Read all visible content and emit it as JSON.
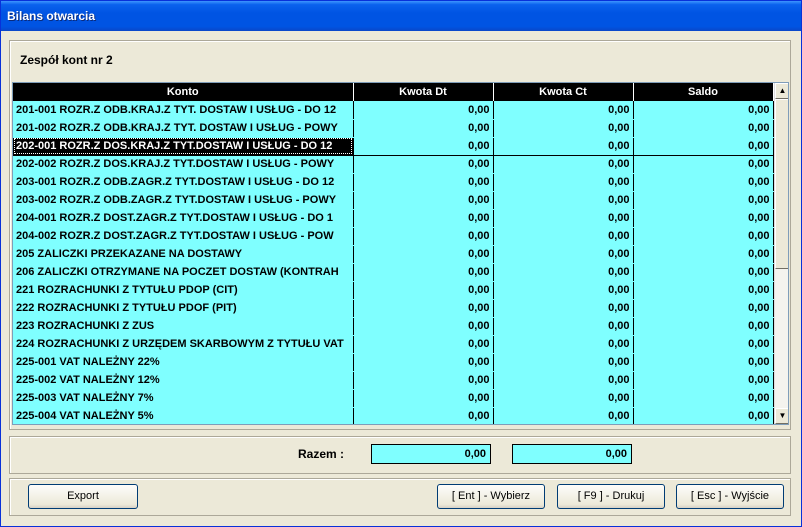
{
  "window": {
    "title": "Bilans otwarcia"
  },
  "group": {
    "title": "Zespół kont nr 2"
  },
  "table": {
    "columns": [
      "Konto",
      "Kwota Dt",
      "Kwota Ct",
      "Saldo"
    ],
    "selected_index": 2,
    "rows": [
      [
        "201-001  ROZR.Z ODB.KRAJ.Z TYT. DOSTAW I USŁUG - DO 12",
        "0,00",
        "0,00",
        "0,00"
      ],
      [
        "201-002  ROZR.Z ODB.KRAJ.Z TYT. DOSTAW I USŁUG - POWY",
        "0,00",
        "0,00",
        "0,00"
      ],
      [
        "202-001  ROZR.Z DOS.KRAJ.Z TYT.DOSTAW I USŁUG - DO 12",
        "0,00",
        "0,00",
        "0,00"
      ],
      [
        "202-002  ROZR.Z DOS.KRAJ.Z TYT.DOSTAW I USŁUG - POWY",
        "0,00",
        "0,00",
        "0,00"
      ],
      [
        "203-001  ROZR.Z ODB.ZAGR.Z TYT.DOSTAW I USŁUG - DO 12",
        "0,00",
        "0,00",
        "0,00"
      ],
      [
        "203-002  ROZR.Z ODB.ZAGR.Z TYT.DOSTAW I USŁUG - POWY",
        "0,00",
        "0,00",
        "0,00"
      ],
      [
        "204-001  ROZR.Z DOST.ZAGR.Z TYT.DOSTAW I USŁUG - DO 1",
        "0,00",
        "0,00",
        "0,00"
      ],
      [
        "204-002  ROZR.Z DOST.ZAGR.Z TYT.DOSTAW I USŁUG - POW",
        "0,00",
        "0,00",
        "0,00"
      ],
      [
        "205  ZALICZKI PRZEKAZANE NA DOSTAWY",
        "0,00",
        "0,00",
        "0,00"
      ],
      [
        "206  ZALICZKI OTRZYMANE NA POCZET DOSTAW (KONTRAH",
        "0,00",
        "0,00",
        "0,00"
      ],
      [
        "221  ROZRACHUNKI Z TYTUŁU PDOP (CIT)",
        "0,00",
        "0,00",
        "0,00"
      ],
      [
        "222  ROZRACHUNKI Z TYTUŁU PDOF (PIT)",
        "0,00",
        "0,00",
        "0,00"
      ],
      [
        "223  ROZRACHUNKI Z ZUS",
        "0,00",
        "0,00",
        "0,00"
      ],
      [
        "224  ROZRACHUNKI Z URZĘDEM SKARBOWYM Z TYTUŁU VAT",
        "0,00",
        "0,00",
        "0,00"
      ],
      [
        "225-001  VAT NALEŻNY 22%",
        "0,00",
        "0,00",
        "0,00"
      ],
      [
        "225-002  VAT NALEŻNY 12%",
        "0,00",
        "0,00",
        "0,00"
      ],
      [
        "225-003  VAT NALEŻNY 7%",
        "0,00",
        "0,00",
        "0,00"
      ],
      [
        "225-004  VAT NALEŻNY 5%",
        "0,00",
        "0,00",
        "0,00"
      ]
    ]
  },
  "scrollbar": {
    "up_glyph": "▲",
    "down_glyph": "▼"
  },
  "summary": {
    "label": "Razem :",
    "dt": "0,00",
    "ct": "0,00"
  },
  "buttons": {
    "export": "Export",
    "enter": "[ Ent ] - Wybierz",
    "print": "[ F9 ] - Drukuj",
    "exit": "[ Esc ] - Wyjście"
  },
  "colors": {
    "grid_cell": "#7fffff",
    "header_bg": "#000000",
    "titlebar": "#0054e3"
  }
}
